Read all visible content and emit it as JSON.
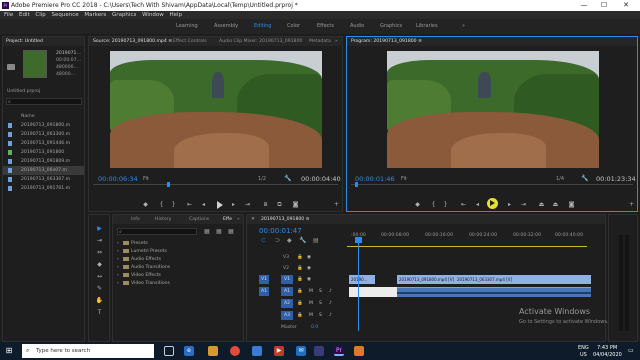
{
  "window": {
    "title": "Adobe Premiere Pro CC 2018 - C:\\Users\\Tech With Shivam\\AppData\\Local\\Temp\\Untitled.prproj *",
    "controls": [
      "—",
      "☐",
      "✕"
    ]
  },
  "menu": [
    "File",
    "Edit",
    "Clip",
    "Sequence",
    "Markers",
    "Graphics",
    "Window",
    "Help"
  ],
  "workspaces": [
    {
      "label": "Learning",
      "active": false
    },
    {
      "label": "Assembly",
      "active": false
    },
    {
      "label": "Editing",
      "active": true
    },
    {
      "label": "Color",
      "active": false
    },
    {
      "label": "Effects",
      "active": false
    },
    {
      "label": "Audio",
      "active": false
    },
    {
      "label": "Graphics",
      "active": false
    },
    {
      "label": "Libraries",
      "active": false
    }
  ],
  "workspace_more": "»",
  "project": {
    "tab": "Project: Untitled",
    "thumb_name": "2019071...",
    "thumb_meta": [
      "00:00:07...",
      "480000...",
      "48000..."
    ],
    "file_name": "Untitled.prproj",
    "search_placeholder": "",
    "column_header": "Name",
    "items": [
      {
        "label": "20190713_091800.m",
        "color": "#6fa0d8"
      },
      {
        "label": "20190713_063300.m",
        "color": "#6fa0d8"
      },
      {
        "label": "20190713_091446.m",
        "color": "#6fa0d8"
      },
      {
        "label": "20190713_091800",
        "color": "#5fb060"
      },
      {
        "label": "20190713_091809.m",
        "color": "#6fa0d8"
      },
      {
        "label": "20190713_06x07.m",
        "color": "#6fa0d8"
      },
      {
        "label": "20190713_063307.m",
        "color": "#6fa0d8"
      },
      {
        "label": "20190713_091701.m",
        "color": "#6fa0d8"
      }
    ]
  },
  "source": {
    "tabs": [
      "Source: 20190713_091800.mp4 ≡",
      "Effect Controls",
      "Audio Clip Mixer: 20190713_091800",
      "Metadata"
    ],
    "tabs_more": "»",
    "timecode": "00:00:06:34",
    "fit": "Fit",
    "scale": "1/2",
    "duration": "00:00:04:40"
  },
  "program": {
    "tab": "Program: 20190713_091800 ≡",
    "timecode": "00:00:01:46",
    "fit": "Fit",
    "scale": "1/4",
    "duration": "00:01:23:34"
  },
  "effects": {
    "tabs": [
      "Info",
      "History",
      "Captions",
      "Effe"
    ],
    "tabs_more": "»",
    "search_placeholder": "",
    "folders": [
      "Presets",
      "Lumetri Presets",
      "Audio Effects",
      "Audio Transitions",
      "Video Effects",
      "Video Transitions"
    ]
  },
  "timeline": {
    "tab": "20190713_091800 ≡",
    "timecode": "00:00:01:47",
    "ruler": [
      ":00:00",
      "00:00:08:00",
      "00:00:16:00",
      "00:00:24:00",
      "00:00:32:00",
      "00:00:40:00"
    ],
    "tracks": [
      {
        "id": "V3",
        "kind": "video"
      },
      {
        "id": "V2",
        "kind": "video"
      },
      {
        "id": "V1",
        "kind": "video",
        "src": "V1"
      },
      {
        "id": "A1",
        "kind": "audio",
        "src": "A1",
        "M": "M",
        "S": "S"
      },
      {
        "id": "A2",
        "kind": "audio",
        "M": "M",
        "S": "S"
      },
      {
        "id": "A3",
        "kind": "audio",
        "M": "M",
        "S": "S"
      }
    ],
    "master": {
      "label": "Master",
      "value": "0.0"
    },
    "clips_video": [
      "20190...",
      "20190713_091800.mp4 [V]",
      "20190713_063307.mp4 [V]"
    ],
    "activate": {
      "line1": "Activate Windows",
      "line2": "Go to Settings to activate Windows."
    }
  },
  "tools": [
    "▶",
    "⇥",
    "⇔",
    "◆",
    "↔",
    "✎",
    "✋",
    "T"
  ],
  "taskbar": {
    "search_placeholder": "Type here to search",
    "time": "7:43 PM",
    "date": "04/04/2020",
    "lang": "ENG",
    "region": "US"
  },
  "colors": {
    "accent": "#2d8ceb",
    "panel": "#1e1e1e",
    "clip_video": "#8fb1e6",
    "clip_audio": "#4a76b8",
    "taskbar": "#0d1b2a"
  }
}
